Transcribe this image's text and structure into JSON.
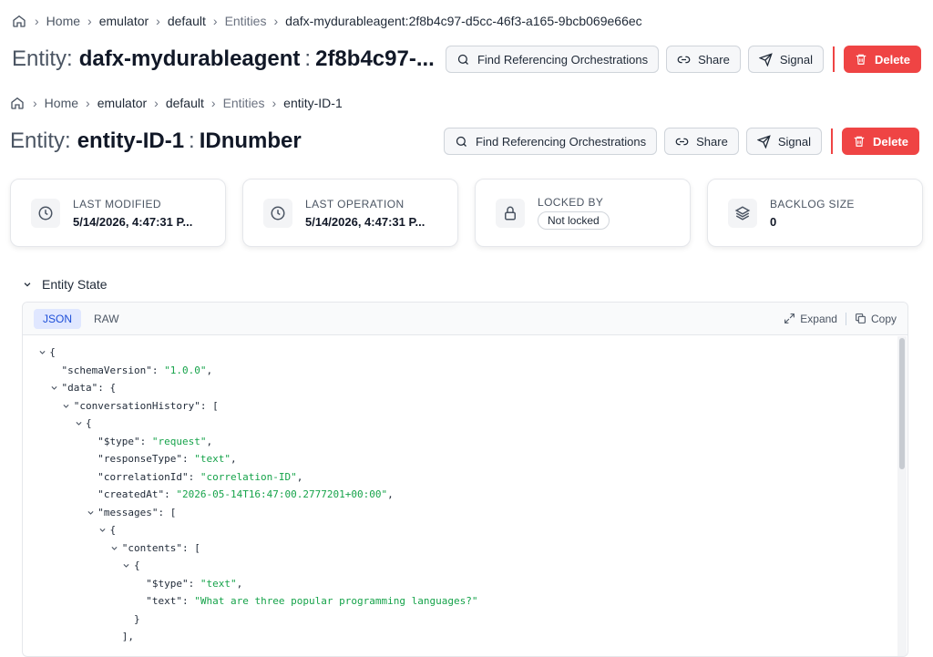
{
  "ghost": {
    "breadcrumb": {
      "home": "Home",
      "emulator": "emulator",
      "default": "default",
      "entities": "Entities",
      "current": "dafx-mydurableagent:2f8b4c97-d5cc-46f3-a165-9bcb069e66ec"
    },
    "title": {
      "label": "Entity:",
      "name": "dafx-mydurableagent",
      "colon": ":",
      "id": "2f8b4c97-..."
    },
    "actions": {
      "find": "Find Referencing Orchestrations",
      "share": "Share",
      "signal": "Signal",
      "delete": "Delete"
    }
  },
  "main": {
    "breadcrumb": {
      "home": "Home",
      "emulator": "emulator",
      "default": "default",
      "entities": "Entities",
      "current": "entity-ID-1"
    },
    "title": {
      "label": "Entity:",
      "name": "entity-ID-1",
      "colon": ":",
      "id": "IDnumber"
    },
    "actions": {
      "find": "Find Referencing Orchestrations",
      "share": "Share",
      "signal": "Signal",
      "delete": "Delete"
    },
    "cards": [
      {
        "label": "LAST MODIFIED",
        "value": "5/14/2026, 4:47:31 P...",
        "icon": "clock-icon"
      },
      {
        "label": "LAST OPERATION",
        "value": "5/14/2026, 4:47:31 P...",
        "icon": "clock-icon"
      },
      {
        "label": "LOCKED BY",
        "value": "Not locked",
        "icon": "lock-icon"
      },
      {
        "label": "BACKLOG SIZE",
        "value": "0",
        "icon": "layers-icon"
      }
    ],
    "state": {
      "title": "Entity State",
      "tabs": [
        "JSON",
        "RAW"
      ],
      "expand": "Expand",
      "copy": "Copy",
      "lines": [
        {
          "caret": true,
          "pre": "",
          "key": "",
          "val": "{",
          "vtype": "p"
        },
        {
          "caret": false,
          "pre": "  ",
          "key": "\"schemaVersion\"",
          "sep": ": ",
          "val": "\"1.0.0\"",
          "vtype": "s",
          "post": ","
        },
        {
          "caret": true,
          "pre": "  ",
          "key": "\"data\"",
          "sep": ": ",
          "val": "{",
          "vtype": "p"
        },
        {
          "caret": true,
          "pre": "    ",
          "key": "\"conversationHistory\"",
          "sep": ": ",
          "val": "[",
          "vtype": "p"
        },
        {
          "caret": true,
          "pre": "      ",
          "key": "",
          "val": "{",
          "vtype": "p"
        },
        {
          "caret": false,
          "pre": "        ",
          "key": "\"$type\"",
          "sep": ": ",
          "val": "\"request\"",
          "vtype": "s",
          "post": ","
        },
        {
          "caret": false,
          "pre": "        ",
          "key": "\"responseType\"",
          "sep": ": ",
          "val": "\"text\"",
          "vtype": "s",
          "post": ","
        },
        {
          "caret": false,
          "pre": "        ",
          "key": "\"correlationId\"",
          "sep": ": ",
          "val": "\"correlation-ID\"",
          "vtype": "s",
          "post": ","
        },
        {
          "caret": false,
          "pre": "        ",
          "key": "\"createdAt\"",
          "sep": ": ",
          "val": "\"2026-05-14T16:47:00.2777201+00:00\"",
          "vtype": "s",
          "post": ","
        },
        {
          "caret": true,
          "pre": "        ",
          "key": "\"messages\"",
          "sep": ": ",
          "val": "[",
          "vtype": "p"
        },
        {
          "caret": true,
          "pre": "          ",
          "key": "",
          "val": "{",
          "vtype": "p"
        },
        {
          "caret": true,
          "pre": "            ",
          "key": "\"contents\"",
          "sep": ": ",
          "val": "[",
          "vtype": "p"
        },
        {
          "caret": true,
          "pre": "              ",
          "key": "",
          "val": "{",
          "vtype": "p"
        },
        {
          "caret": false,
          "pre": "                ",
          "key": "\"$type\"",
          "sep": ": ",
          "val": "\"text\"",
          "vtype": "s",
          "post": ","
        },
        {
          "caret": false,
          "pre": "                ",
          "key": "\"text\"",
          "sep": ": ",
          "val": "\"What are three popular programming languages?\"",
          "vtype": "s"
        },
        {
          "caret": false,
          "pre": "              ",
          "key": "",
          "val": "}",
          "vtype": "p"
        },
        {
          "caret": false,
          "pre": "            ",
          "key": "",
          "val": "],",
          "vtype": "p"
        }
      ]
    }
  },
  "colors": {
    "danger": "#ef4444",
    "string": "#16a34a",
    "accent": "#1d4ed8"
  }
}
